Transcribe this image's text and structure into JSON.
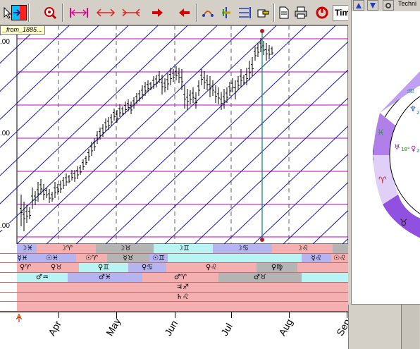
{
  "toolbar": {
    "timeframe_label": "Tim",
    "buttons": [
      "cursor-icon",
      "color-picker-icon",
      "zoom-icon",
      "stretch-horizontal-icon",
      "expand-arrows-icon",
      "compress-arrows-icon",
      "arrow-right-icon",
      "arrow-left-icon",
      "arc-tool-icon",
      "planet-lines-icon",
      "gann-fan-icon",
      "hand-pointer-icon",
      "document-icon",
      "print-icon",
      "reset-icon"
    ]
  },
  "series_tag": "_from_1885...",
  "chart": {
    "price_labels": [
      ".00",
      ".00",
      ".00"
    ],
    "months": [
      "Apr",
      "May",
      "Jun",
      "Jul",
      "Aug",
      "Sep"
    ],
    "colors": {
      "horizontal_lines": "#c000c0",
      "diagonal_lines": "#1a1aa0",
      "vertical_grid": "#606060",
      "bars": "#000000",
      "marker_line": "#008080",
      "marker_dot": "#b02020"
    }
  },
  "bands": {
    "rows": [
      {
        "segments": [
          {
            "color": "#b4b4f0",
            "glyph": "☽♓"
          },
          {
            "color": "#f4b0b0",
            "glyph": "☽♈"
          },
          {
            "color": "#b4b4b4",
            "glyph": "☽♉"
          },
          {
            "color": "#b8f4f4",
            "glyph": "☽♊"
          },
          {
            "color": "#b4b4f0",
            "glyph": "☽♋"
          },
          {
            "color": "#f4b0b0",
            "glyph": "☽♌"
          },
          {
            "color": "#b4b4b4",
            "glyph": ""
          }
        ]
      },
      {
        "segments": [
          {
            "color": "#b4b4f0",
            "glyph": "☿♓"
          },
          {
            "color": "#b4b4f0",
            "glyph": "☉♓"
          },
          {
            "color": "#f4b0b0",
            "glyph": "☉♈"
          },
          {
            "color": "#b4b4b4",
            "glyph": "☿♉"
          },
          {
            "color": "#b4b4f0",
            "glyph": "☉♊"
          },
          {
            "color": "#b8f4f4",
            "glyph": ""
          },
          {
            "color": "#b4b4f0",
            "glyph": "☿♌"
          },
          {
            "color": "#f4b0b0",
            "glyph": "☉♌"
          }
        ]
      },
      {
        "segments": [
          {
            "color": "#f4b0b0",
            "glyph": "♀♈"
          },
          {
            "color": "#f4b0b0",
            "glyph": "♀♉"
          },
          {
            "color": "#b8f4f4",
            "glyph": "♀♊"
          },
          {
            "color": "#b4b4f0",
            "glyph": "♀♋"
          },
          {
            "color": "#f4b0b0",
            "glyph": "♀♌"
          },
          {
            "color": "#b4b4b4",
            "glyph": "♀♍"
          },
          {
            "color": "#f4b0b0",
            "glyph": ""
          }
        ]
      },
      {
        "segments": [
          {
            "color": "#b8f4f4",
            "glyph": "♂♒"
          },
          {
            "color": "#b4b4f0",
            "glyph": "♂♓"
          },
          {
            "color": "#f4b0b0",
            "glyph": "♂♈"
          },
          {
            "color": "#b4b4b4",
            "glyph": "♂♉"
          },
          {
            "color": "#b8f4f4",
            "glyph": ""
          }
        ]
      },
      {
        "segments": [
          {
            "color": "#f4b0b0",
            "glyph": "♃♐"
          }
        ]
      },
      {
        "segments": [
          {
            "color": "#f4b0b0",
            "glyph": "♄♌"
          }
        ]
      },
      {
        "segments": [
          {
            "color": "#f4b0b0",
            "glyph": ""
          }
        ]
      }
    ]
  },
  "right_window": {
    "title": "Techni",
    "glyphs": [
      {
        "sym": "♒",
        "color": "#208080"
      },
      {
        "sym": "♆",
        "color": "#2060c0"
      },
      {
        "sym": "2",
        "color": "#208080"
      },
      {
        "sym": "♓",
        "color": "#20a040"
      },
      {
        "sym": "♅",
        "color": "#a020a0"
      },
      {
        "sym": "18°",
        "color": "#208020"
      },
      {
        "sym": "♀",
        "color": "#a020a0"
      },
      {
        "sym": "2",
        "color": "#208080"
      },
      {
        "sym": "♈",
        "color": "#c02020"
      },
      {
        "sym": "♉",
        "color": "#202020"
      }
    ]
  }
}
